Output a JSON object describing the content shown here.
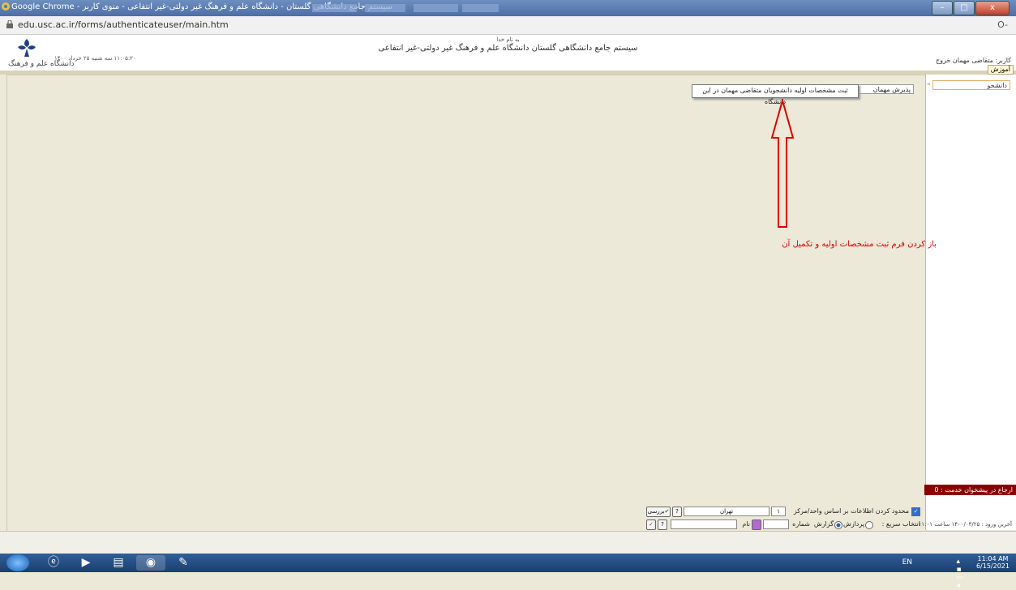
{
  "window": {
    "title": "سیستم جامع دانشگاهی گلستان - دانشگاه علم و فرهنگ غیر دولتی-غیر انتفاعی - منوی کاربر - Google Chrome",
    "minimize": "–",
    "maximize": "□",
    "close": "x"
  },
  "browser": {
    "url": "edu.usc.ac.ir/forms/authenticateuser/main.htm",
    "lock_icon": "lock-icon",
    "key_icon": "key-icon",
    "key_symbol": "O-"
  },
  "header": {
    "bismillah": "به نام خدا",
    "system_title": "سیستم جامع دانشگاهی گلستان   دانشگاه علم و فرهنگ غیر دولتی-غیر انتفاعی",
    "datetime": "۱۱:۰۵:۲۰ سه شنبه ۲۵ خرداد ۱۴۰۰",
    "user_info": "کاربر: متقاضی مهمان   خروج",
    "logo_text": "دانشگاه علم و فرهنگ",
    "tab_label": "آموزش"
  },
  "sidebar": {
    "student_item": "دانشجو",
    "arrow": "«"
  },
  "menu": {
    "guest_accept": "پذیرش مهمان",
    "submenu_item": "ثبت مشخصات اولیه دانشجویان متقاضی مهمان در این دانشگاه"
  },
  "annotation": {
    "text": "باز کردن فرم ثبت مشخصات اولیه و تکمیل آن",
    "color": "#dd0000"
  },
  "bottom": {
    "limit_label": "محدود کردن اطلاعات بر اساس واحد/مرکز",
    "unit_code": "۱",
    "unit_name": "تهران",
    "review_button": "بررسی",
    "help_symbol": "?",
    "quick_select_label": "انتخاب سریع :",
    "radio_process": "پردازش",
    "radio_report": "گزارش",
    "number_label": "شماره",
    "name_label": "نام",
    "reject_bar": "ارجاع در پیشخوان خدمت : 0",
    "last_visit": "آخرین ورود : ۱۴۰۰/۰۳/۲۵ ساعت ۱۱:۰۱"
  },
  "taskbar": {
    "lang": "EN",
    "time": "11:04 AM",
    "date": "6/15/2021",
    "tray_arrows": "▴ ▪ ▭ ◂"
  },
  "colors": {
    "reject_bar_bg": "#8b0000",
    "content_bg": "#ece9d8"
  }
}
